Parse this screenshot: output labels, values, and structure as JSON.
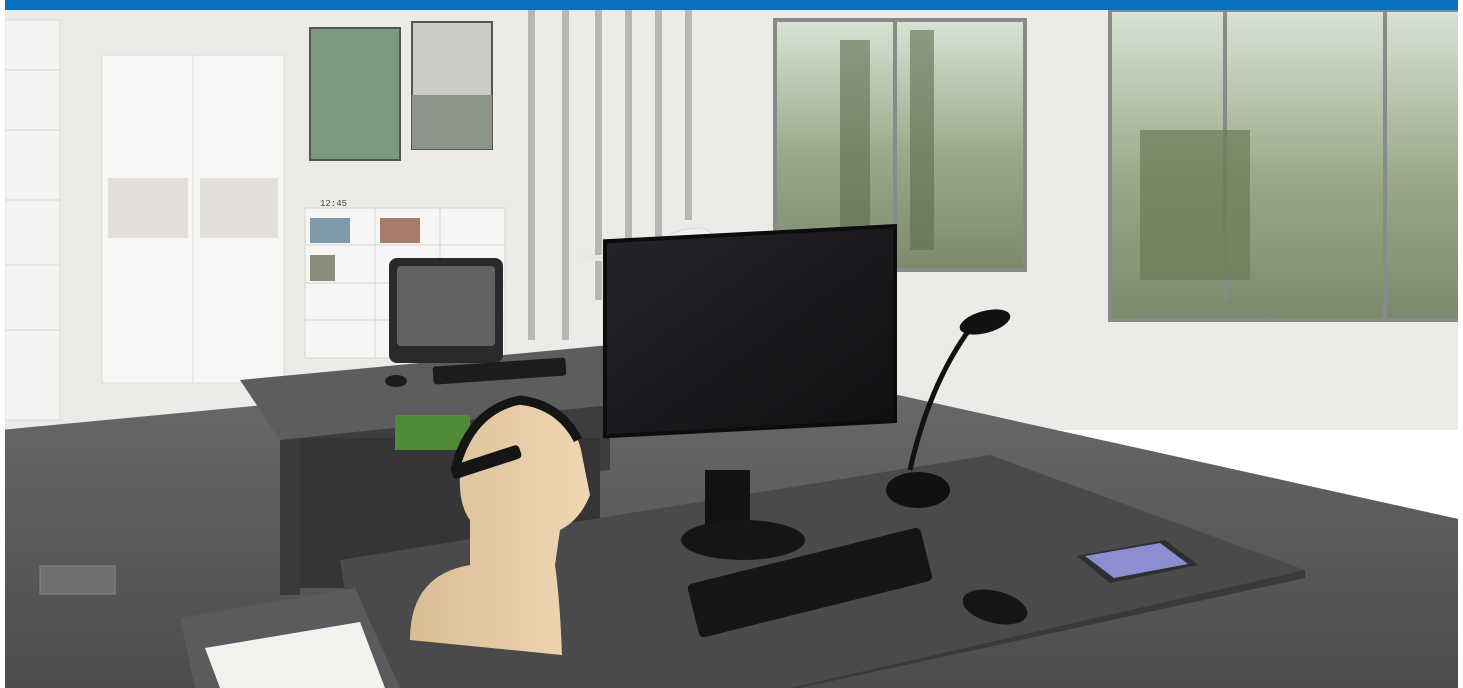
{
  "colors": {
    "accent_bar": "#0b6fc0",
    "wall": "#eceae6",
    "floor": "#57585a",
    "desk_top": "#4a4a4c",
    "monitor": "#1a1b1d"
  },
  "scene": {
    "description_tags": [
      "office",
      "desk",
      "monitor",
      "keyboard",
      "mouse",
      "desk-lamp",
      "mannequin-head",
      "eeg-headset",
      "office-chair",
      "bookshelf",
      "windows",
      "tablet",
      "papers"
    ]
  },
  "clock_display": "12:45"
}
